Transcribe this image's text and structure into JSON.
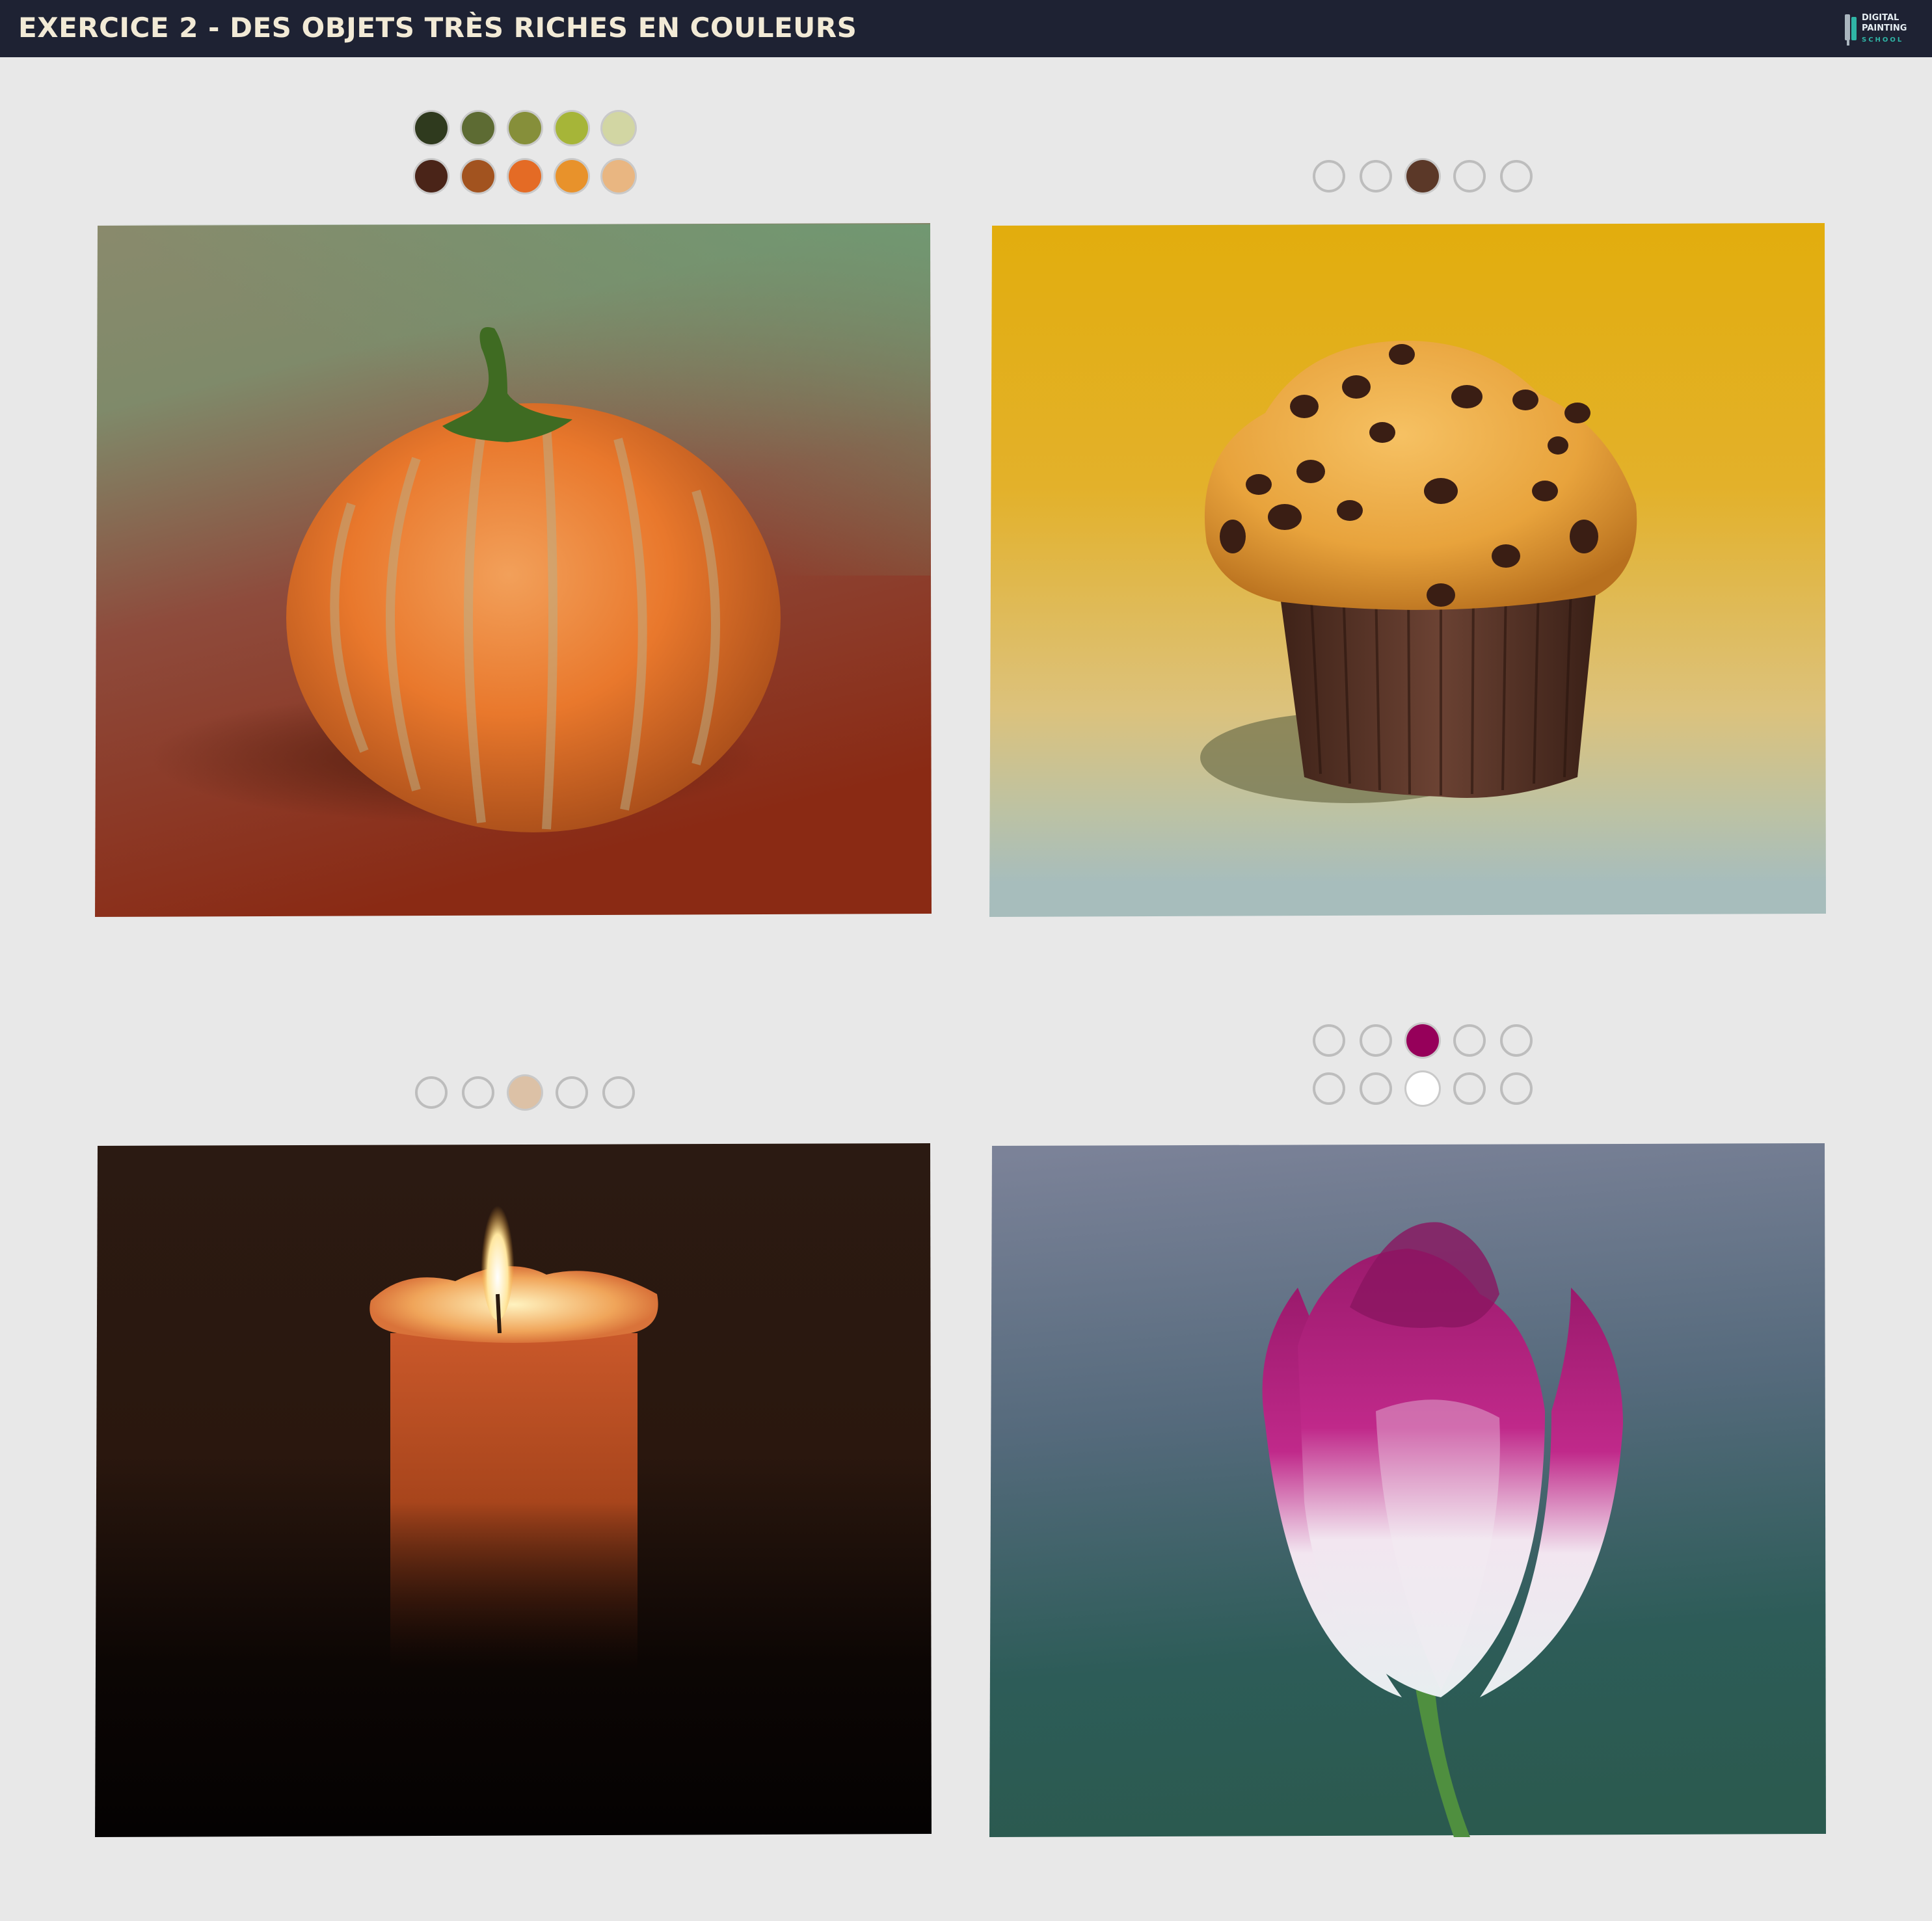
{
  "header": {
    "title": "EXERCICE 2 - DES OBJETS TRÈS RICHES EN COULEURS",
    "logo_line1": "DIGITAL",
    "logo_line2": "PAINTING",
    "logo_line3": "SCHOOL"
  },
  "palettes": {
    "pumpkin": [
      [
        "#2f3a1e",
        "#5d6b33",
        "#868f3a",
        "#a6b538",
        "#d2d6a3"
      ],
      [
        "#4a2418",
        "#a2531f",
        "#e46b25",
        "#e8922b",
        "#e9b681"
      ]
    ],
    "muffin": [
      [
        null,
        null,
        "#5b3828",
        null,
        null
      ]
    ],
    "candle": [
      [
        null,
        null,
        "#dcc1a6",
        null,
        null
      ]
    ],
    "tulip": [
      [
        null,
        null,
        "#96005a",
        null,
        null
      ],
      [
        null,
        null,
        "#ffffff",
        null,
        null
      ]
    ]
  },
  "artworks": {
    "pumpkin": "pumpkin-painting",
    "muffin": "muffin-painting",
    "candle": "candle-painting",
    "tulip": "tulip-painting"
  }
}
